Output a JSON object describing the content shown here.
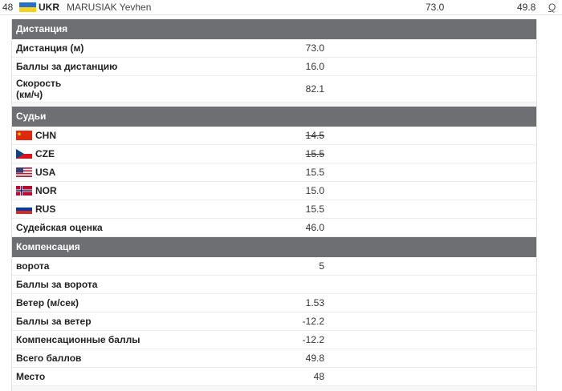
{
  "top_row": {
    "rank": "48",
    "nation": "UKR",
    "athlete": "MARUSIAK Yevhen",
    "distance": "73.0",
    "total": "49.8",
    "search_label": "Q",
    "flag_colors": [
      "#2a6fc9",
      "#f4d31e"
    ]
  },
  "distance_section": {
    "title": "Дистанция",
    "rows": [
      {
        "label": "Дистанция (м)",
        "value": "73.0"
      },
      {
        "label": "Баллы за дистанцию",
        "value": "16.0"
      },
      {
        "label": "Скорость\n(км/ч)",
        "value": "82.1"
      }
    ]
  },
  "judges_section": {
    "title": "Судьи",
    "judges": [
      {
        "nation": "CHN",
        "score": "14.5",
        "struck": true
      },
      {
        "nation": "CZE",
        "score": "15.5",
        "struck": true
      },
      {
        "nation": "USA",
        "score": "15.5",
        "struck": false
      },
      {
        "nation": "NOR",
        "score": "15.0",
        "struck": false
      },
      {
        "nation": "RUS",
        "score": "15.5",
        "struck": false
      }
    ],
    "judge_points": {
      "label": "Судейская оценка",
      "value": "46.0"
    }
  },
  "compensation_section": {
    "title": "Компенсация",
    "rows": [
      {
        "label": "ворота",
        "value": "5"
      },
      {
        "label": "Баллы за ворота",
        "value": ""
      },
      {
        "label": "Ветер (м/сек)",
        "value": "1.53"
      },
      {
        "label": "Баллы за ветер",
        "value": "-12.2"
      },
      {
        "label": "Компенсационные баллы",
        "value": "-12.2"
      },
      {
        "label": "Всего баллов",
        "value": "49.8"
      },
      {
        "label": "Место",
        "value": "48"
      }
    ]
  },
  "colors": {
    "header_bg": "#6e6f73",
    "header_text": "#ffffff",
    "row_bg": "#ffffff"
  }
}
